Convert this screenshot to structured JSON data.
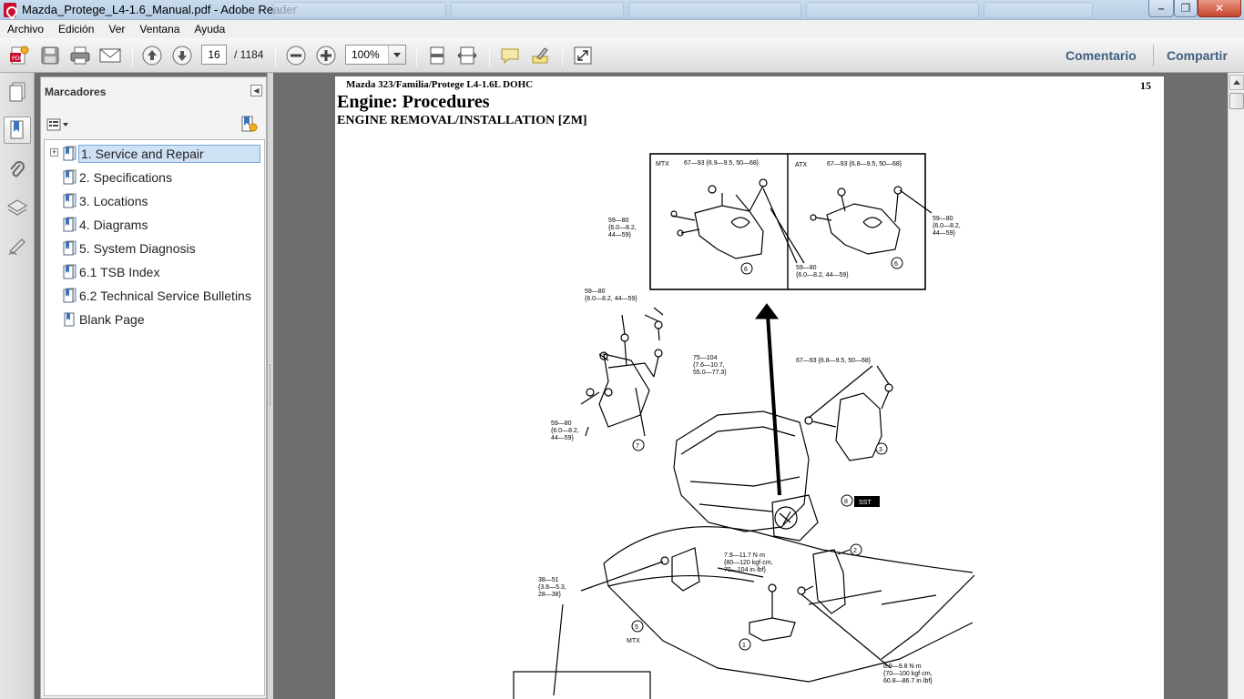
{
  "window": {
    "title": "Mazda_Protege_L4-1.6_Manual.pdf - Adobe Reader",
    "minimize_glyph": "–",
    "maximize_glyph": "❐",
    "close_glyph": "✕"
  },
  "menu": [
    "Archivo",
    "Edición",
    "Ver",
    "Ventana",
    "Ayuda"
  ],
  "toolbar": {
    "page_current": "16",
    "page_total": "/ 1184",
    "zoom": "100%",
    "comment_link": "Comentario",
    "share_link": "Compartir",
    "icons": [
      "create-pdf-icon",
      "save-icon",
      "print-icon",
      "email-icon",
      "previous-page-icon",
      "next-page-icon",
      "zoom-out-icon",
      "zoom-in-icon",
      "fit-page-icon",
      "fit-width-icon",
      "comment-icon",
      "highlight-icon",
      "read-mode-icon"
    ]
  },
  "sidebar": {
    "panel_title": "Marcadores",
    "rail_icons": [
      "pages-icon",
      "bookmarks-icon",
      "attachments-icon",
      "layers-icon",
      "signatures-icon"
    ],
    "bookmarks": [
      {
        "label": "1. Service and Repair",
        "expandable": true,
        "selected": true
      },
      {
        "label": "2. Specifications",
        "expandable": false,
        "selected": false
      },
      {
        "label": "3. Locations",
        "expandable": false,
        "selected": false
      },
      {
        "label": "4. Diagrams",
        "expandable": false,
        "selected": false
      },
      {
        "label": "5. System Diagnosis",
        "expandable": false,
        "selected": false
      },
      {
        "label": "6.1 TSB Index",
        "expandable": false,
        "selected": false
      },
      {
        "label": "6.2 Technical Service Bulletins",
        "expandable": false,
        "selected": false
      },
      {
        "label": "Blank Page",
        "expandable": false,
        "selected": false
      }
    ]
  },
  "document": {
    "header": "Mazda 323/Familia/Protege L4-1.6L DOHC",
    "page_number": "15",
    "title": "Engine: Procedures",
    "subtitle": "ENGINE REMOVAL/INSTALLATION [ZM]",
    "diagram_labels": {
      "mtx": "MTX",
      "atx": "ATX",
      "mtx_torque": "67—93 {6.9—9.5, 50—68}",
      "atx_torque": "67—93 {6.8—9.5, 50—68}",
      "left_torque_1": "59—80",
      "left_torque_2": "{6.0—8.2,",
      "left_torque_3": "44—59}",
      "right_torque_1": "59—80",
      "right_torque_2": "{6.0—8.2,",
      "right_torque_3": "44—59}",
      "mid_torque_1": "59—80",
      "mid_torque_2": "{6.0—8.2, 44—59}",
      "top_torque_1": "59—80",
      "top_torque_2": "{6.0—8.2, 44—59}",
      "t75_1": "75—104",
      "t75_2": "{7.6—10.7,",
      "t75_3": "55.0—77.3}",
      "t67_right": "67—93 {6.8—9.5, 50—68}",
      "left2_1": "59—80",
      "left2_2": "{6.0—8.2,",
      "left2_3": "44—59}",
      "sst": "SST",
      "t79_1": "7.9—11.7 N·m",
      "t79_2": "{80—120 kgf·cm,",
      "t79_3": "70—104 in·lbf}",
      "t38_1": "38—51",
      "t38_2": "{3.8—5.3,",
      "t38_3": "28—38}",
      "mtx_bottom": "MTX",
      "t69_1": "6.9—9.8 N·m",
      "t69_2": "{70—100 kgf·cm,",
      "t69_3": "60.8—86.7 in·lbf}",
      "c1": "1",
      "c2": "2",
      "c3": "3",
      "c5": "5",
      "c6a": "6",
      "c6b": "6",
      "c7": "7",
      "c8": "8"
    }
  }
}
